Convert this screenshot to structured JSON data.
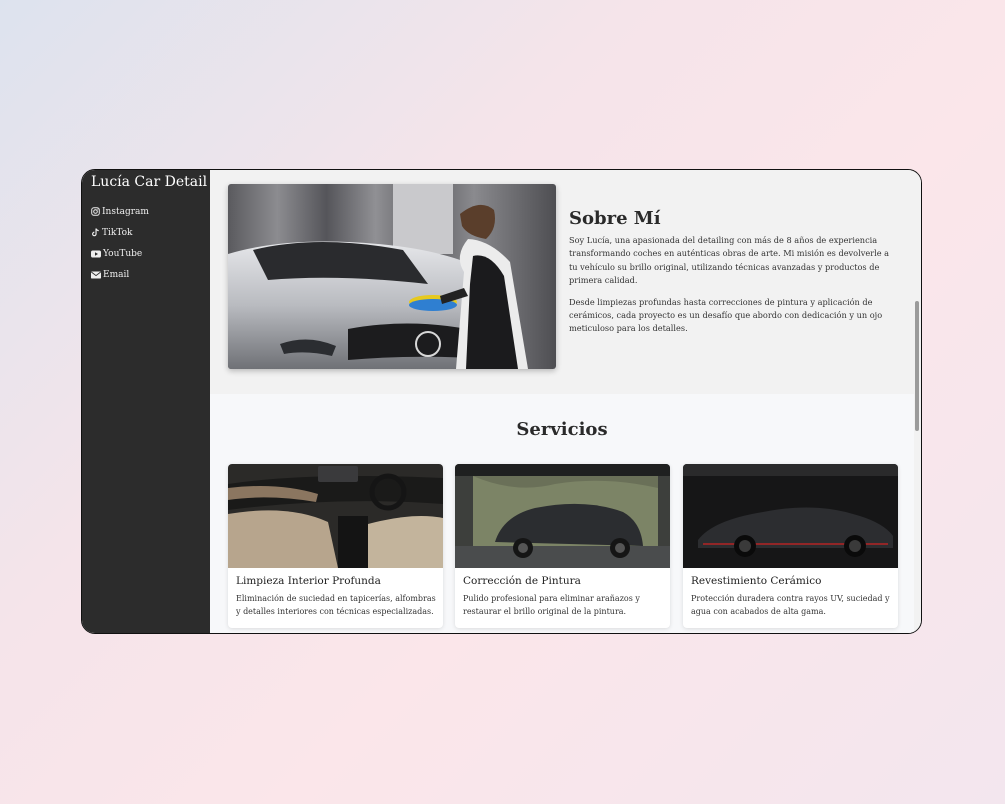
{
  "sidebar": {
    "brand": "Lucía Car Detail",
    "items": [
      {
        "label": "Instagram",
        "icon": "instagram-icon"
      },
      {
        "label": "TikTok",
        "icon": "tiktok-icon"
      },
      {
        "label": "YouTube",
        "icon": "youtube-icon"
      },
      {
        "label": "Email",
        "icon": "envelope-icon"
      }
    ],
    "toggle": "≡"
  },
  "about": {
    "title": "Sobre Mí",
    "paragraphs": [
      "Soy Lucía, una apasionada del detailing con más de 8 años de experiencia transformando coches en auténticas obras de arte. Mi misión es devolverle a tu vehículo su brillo original, utilizando técnicas avanzadas y productos de primera calidad.",
      "Desde limpiezas profundas hasta correcciones de pintura y aplicación de cerámicos, cada proyecto es un desafío que abordo con dedicación y un ojo meticuloso para los detalles."
    ]
  },
  "services": {
    "title": "Servicios",
    "cards": [
      {
        "title": "Limpieza Interior Profunda",
        "description": "Eliminación de suciedad en tapicerías, alfombras y detalles interiores con técnicas especializadas."
      },
      {
        "title": "Corrección de Pintura",
        "description": "Pulido profesional para eliminar arañazos y restaurar el brillo original de la pintura."
      },
      {
        "title": "Revestimiento Cerámico",
        "description": "Protección duradera contra rayos UV, suciedad y agua con acabados de alta gama."
      }
    ]
  },
  "colors": {
    "sidebar_bg": "#2c2c2c",
    "content_bg": "#f2f2f2",
    "services_bg": "#f7f8fa"
  }
}
